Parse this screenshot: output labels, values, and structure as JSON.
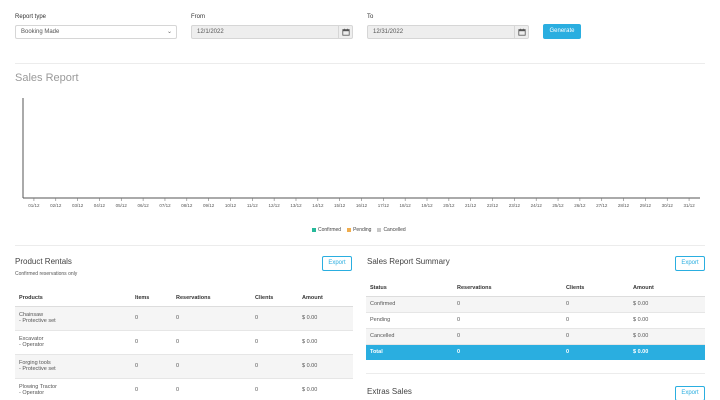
{
  "filters": {
    "report_type_label": "Report type",
    "report_type_value": "Booking Made",
    "from_label": "From",
    "from_value": "12/1/2022",
    "to_label": "To",
    "to_value": "12/31/2022",
    "generate_label": "Generate"
  },
  "report": {
    "title": "Sales Report"
  },
  "chart_data": {
    "type": "bar",
    "categories": [
      "01/12",
      "02/12",
      "03/12",
      "04/12",
      "05/12",
      "06/12",
      "07/12",
      "08/12",
      "09/12",
      "10/12",
      "11/12",
      "12/12",
      "13/12",
      "14/12",
      "15/12",
      "16/12",
      "17/12",
      "18/12",
      "19/12",
      "20/12",
      "21/12",
      "22/12",
      "23/12",
      "24/12",
      "25/12",
      "26/12",
      "27/12",
      "28/12",
      "29/12",
      "30/12",
      "31/12"
    ],
    "series": [
      {
        "name": "Confirmed",
        "color": "#26b99a",
        "values": [
          0,
          0,
          0,
          0,
          0,
          0,
          0,
          0,
          0,
          0,
          0,
          0,
          0,
          0,
          0,
          0,
          0,
          0,
          0,
          0,
          0,
          0,
          0,
          0,
          0,
          0,
          0,
          0,
          0,
          0,
          0
        ]
      },
      {
        "name": "Pending",
        "color": "#f0ad4e",
        "values": [
          0,
          0,
          0,
          0,
          0,
          0,
          0,
          0,
          0,
          0,
          0,
          0,
          0,
          0,
          0,
          0,
          0,
          0,
          0,
          0,
          0,
          0,
          0,
          0,
          0,
          0,
          0,
          0,
          0,
          0,
          0
        ]
      },
      {
        "name": "Cancelled",
        "color": "#c8c8c8",
        "values": [
          0,
          0,
          0,
          0,
          0,
          0,
          0,
          0,
          0,
          0,
          0,
          0,
          0,
          0,
          0,
          0,
          0,
          0,
          0,
          0,
          0,
          0,
          0,
          0,
          0,
          0,
          0,
          0,
          0,
          0,
          0
        ]
      }
    ],
    "title": "",
    "xlabel": "",
    "ylabel": "",
    "legend": "bottom-center",
    "grid": false
  },
  "product_rentals": {
    "title": "Product Rentals",
    "subtitle": "Confirmed reservations only",
    "export_label": "Export",
    "headers": [
      "Products",
      "Items",
      "Reservations",
      "Clients",
      "Amount"
    ],
    "rows": [
      {
        "product": "Chainsaw",
        "sub": "- Protective set",
        "items": "0",
        "reservations": "0",
        "clients": "0",
        "amount": "$ 0.00"
      },
      {
        "product": "Excavator",
        "sub": "- Operator",
        "items": "0",
        "reservations": "0",
        "clients": "0",
        "amount": "$ 0.00"
      },
      {
        "product": "Forging tools",
        "sub": "- Protective set",
        "items": "0",
        "reservations": "0",
        "clients": "0",
        "amount": "$ 0.00"
      },
      {
        "product": "Plowing Tractor",
        "sub": "- Operator",
        "items": "0",
        "reservations": "0",
        "clients": "0",
        "amount": "$ 0.00"
      }
    ]
  },
  "summary": {
    "title": "Sales Report Summary",
    "export_label": "Export",
    "headers": [
      "Status",
      "Reservations",
      "Clients",
      "Amount"
    ],
    "rows": [
      {
        "status": "Confirmed",
        "reservations": "0",
        "clients": "0",
        "amount": "$ 0.00"
      },
      {
        "status": "Pending",
        "reservations": "0",
        "clients": "0",
        "amount": "$ 0.00"
      },
      {
        "status": "Cancelled",
        "reservations": "0",
        "clients": "0",
        "amount": "$ 0.00"
      }
    ],
    "total": {
      "status": "Total",
      "reservations": "0",
      "clients": "0",
      "amount": "$ 0.00"
    }
  },
  "extras": {
    "title": "Extras Sales",
    "export_label": "Export"
  }
}
